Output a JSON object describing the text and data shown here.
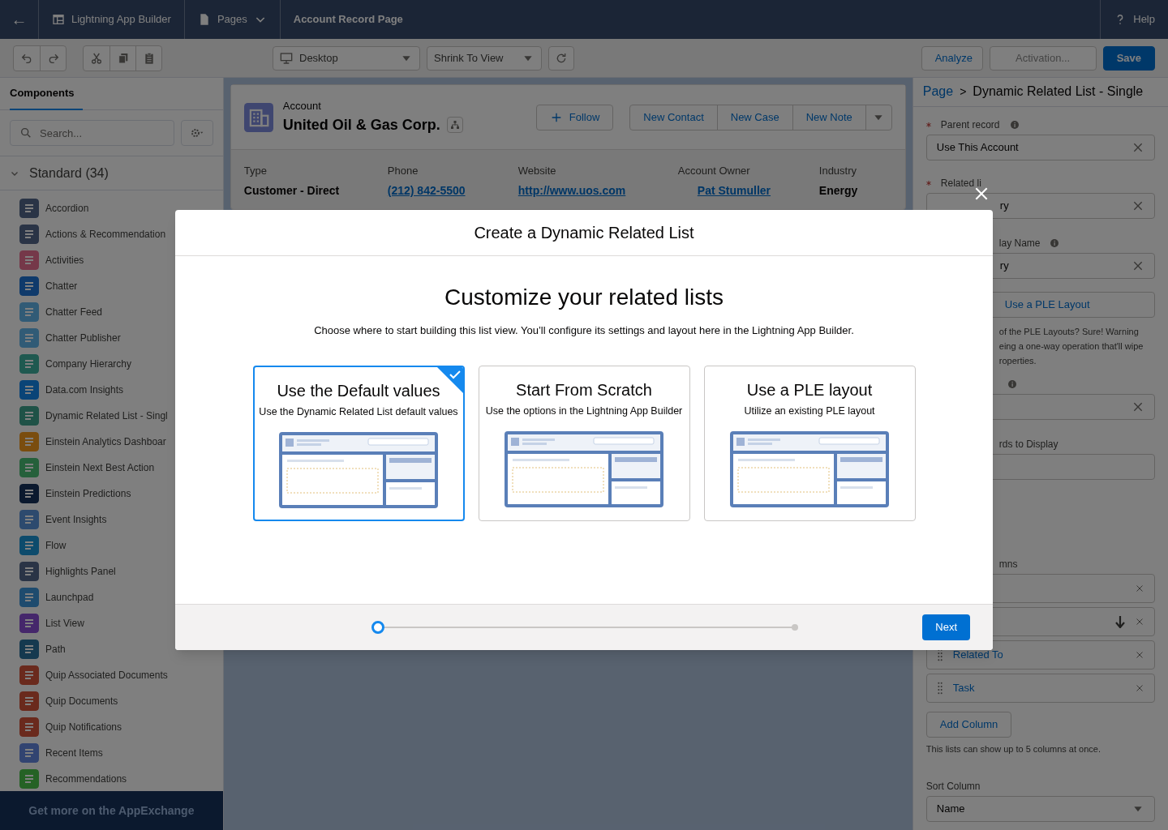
{
  "header": {
    "back": "←",
    "app": "Lightning App Builder",
    "pages": "Pages",
    "page_title": "Account Record Page",
    "help": "Help"
  },
  "toolbar": {
    "device": "Desktop",
    "zoom": "Shrink To View",
    "buttons": [
      {
        "label": "Analyze",
        "kind": "outline",
        "disabled": false
      },
      {
        "label": "Activation...",
        "kind": "outline",
        "disabled": true
      },
      {
        "label": "Save",
        "kind": "brand",
        "disabled": false
      }
    ]
  },
  "sidebar": {
    "tab": "Components",
    "search_placeholder": "Search...",
    "section": "Standard (34)",
    "expanded": true,
    "items": [
      {
        "label": "Accordion",
        "color": "#2a3446"
      },
      {
        "label": "Actions & Recommendation",
        "color": "#2a3446"
      },
      {
        "label": "Activities",
        "color": "#753849"
      },
      {
        "label": "Chatter",
        "color": "#0f3a6b"
      },
      {
        "label": "Chatter Feed",
        "color": "#315b76"
      },
      {
        "label": "Chatter Publisher",
        "color": "#315b76"
      },
      {
        "label": "Company Hierarchy",
        "color": "#1f5950"
      },
      {
        "label": "Data.com Insights",
        "color": "#0a4477"
      },
      {
        "label": "Dynamic Related List - Singl",
        "color": "#1f5247"
      },
      {
        "label": "Einstein Analytics Dashboar",
        "color": "#7a4d0f"
      },
      {
        "label": "Einstein Next Best Action",
        "color": "#25603b"
      },
      {
        "label": "Einstein Predictions",
        "color": "#0b192e"
      },
      {
        "label": "Event Insights",
        "color": "#2d4a6e"
      },
      {
        "label": "Flow",
        "color": "#0d4b6c"
      },
      {
        "label": "Highlights Panel",
        "color": "#2a3446"
      },
      {
        "label": "Launchpad",
        "color": "#1e4b6e"
      },
      {
        "label": "List View",
        "color": "#45276b"
      },
      {
        "label": "Path",
        "color": "#15394f"
      },
      {
        "label": "Quip Associated Documents",
        "color": "#6a2a1d"
      },
      {
        "label": "Quip Documents",
        "color": "#6a2a1d"
      },
      {
        "label": "Quip Notifications",
        "color": "#6a2a1d"
      },
      {
        "label": "Recent Items",
        "color": "#324471"
      },
      {
        "label": "Recommendations",
        "color": "#256225"
      }
    ],
    "footer": "Get more on the AppExchange"
  },
  "record": {
    "object": "Account",
    "name": "United Oil & Gas Corp.",
    "follow": "Follow",
    "actions": [
      "New Contact",
      "New Case",
      "New Note"
    ],
    "fields": [
      {
        "label": "Type",
        "value": "Customer - Direct",
        "kind": "text"
      },
      {
        "label": "Phone",
        "value": "(212) 842-5500",
        "kind": "link"
      },
      {
        "label": "Website",
        "value": "http://www.uos.com",
        "kind": "link"
      },
      {
        "label": "Account Owner",
        "value": "Pat Stumuller",
        "kind": "link"
      },
      {
        "label": "Industry",
        "value": "Energy",
        "kind": "text"
      }
    ]
  },
  "properties": {
    "breadcrumb_link": "Page",
    "breadcrumb_sep": ">",
    "breadcrumb_current": "Dynamic Related List - Single",
    "rows": [
      {
        "kind": "label",
        "text": "Parent record",
        "required": true,
        "info": true
      },
      {
        "kind": "field",
        "value": "Use This Account"
      },
      {
        "kind": "label",
        "text": "Related li",
        "required": true,
        "info": false
      },
      {
        "kind": "field-cut",
        "value": "ry",
        "clear": true
      },
      {
        "kind": "label-cut",
        "text": "lay Name",
        "info": true
      },
      {
        "kind": "field-cut",
        "value": "ry",
        "clear": true
      },
      {
        "kind": "button-cut",
        "text": "Use a PLE Layout"
      },
      {
        "kind": "note-cut",
        "lines": [
          "of the PLE Layouts?  Sure! Warning",
          "eing a one-way operation that'll wipe",
          "roperties."
        ]
      },
      {
        "kind": "info-cut"
      },
      {
        "kind": "field-cut",
        "clear": true
      },
      {
        "kind": "label-cut",
        "text": "rds to Display",
        "info": false
      },
      {
        "kind": "field-cut",
        "clear": false
      },
      {
        "kind": "section-label-cut",
        "text": "mns",
        "info": false
      },
      {
        "kind": "column",
        "sorted": false
      },
      {
        "kind": "column",
        "sorted": true
      },
      {
        "kind": "column",
        "text": "Related To",
        "sorted": false
      },
      {
        "kind": "column",
        "text": "Task",
        "sorted": false
      },
      {
        "kind": "button",
        "text": "Add Column"
      },
      {
        "kind": "note",
        "text": "This lists can show up to 5 columns at once."
      },
      {
        "kind": "label",
        "text": "Sort Column",
        "required": false,
        "info": false
      },
      {
        "kind": "select",
        "value": "Name"
      }
    ]
  },
  "modal": {
    "title": "Create a Dynamic Related List",
    "heading": "Customize your related lists",
    "intro": "Choose where to start building this list view. You’ll configure its settings and layout here in the Lightning App Builder.",
    "options": [
      {
        "title": "Use the Default values",
        "subtitle": "Use the Dynamic Related List default values",
        "selected": true
      },
      {
        "title": "Start From Scratch",
        "subtitle": "Use the options in the Lightning App Builder",
        "selected": false
      },
      {
        "title": "Use a PLE layout",
        "subtitle": "Utilize an existing PLE layout",
        "selected": false
      }
    ],
    "progress": {
      "level": 0
    },
    "next": "Next"
  }
}
